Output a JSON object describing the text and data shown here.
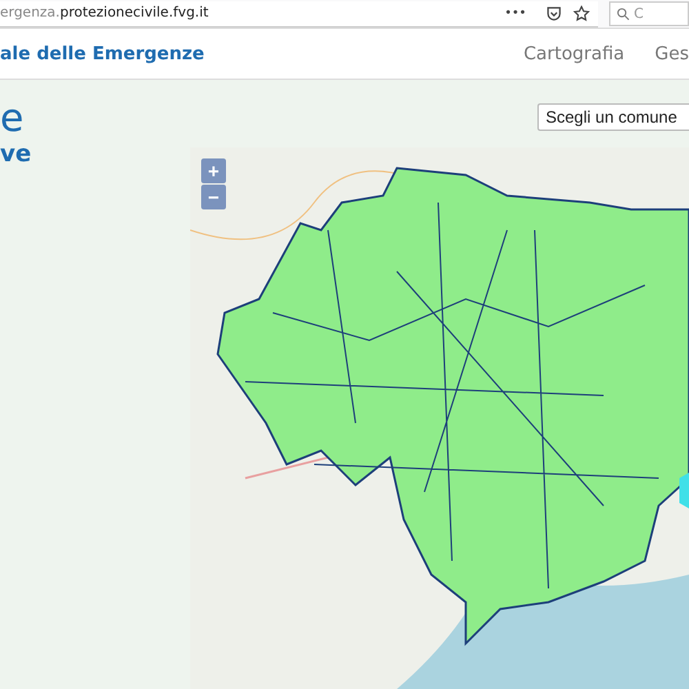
{
  "browser": {
    "url_prefix": "ergenza.",
    "url_domain": "protezionecivile.fvg.it",
    "menu": "•••",
    "search_placeholder": "C"
  },
  "header": {
    "title": "ale delle Emergenze",
    "nav": [
      {
        "label": "Cartografia",
        "selected": false
      },
      {
        "label": "Ges",
        "selected": false
      }
    ]
  },
  "page": {
    "heading": "e",
    "subheading": "ve",
    "select": {
      "value": "Scegli un comune"
    }
  },
  "map": {
    "zoom_in": "+",
    "zoom_out": "−"
  }
}
